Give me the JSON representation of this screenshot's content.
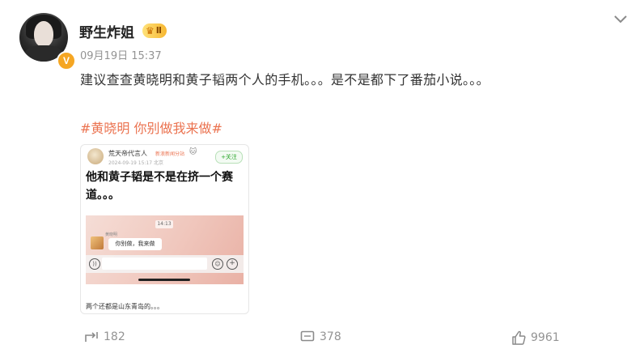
{
  "post": {
    "username": "野生炸姐",
    "level_badge": "Ⅱ",
    "verified_badge": "V",
    "time": "09月19日 15:37",
    "content": "建议查查黄晓明和黄子韬两个人的手机。。。是不是都下了番茄小说。。。",
    "topic": "#黄晓明 你别做我来做#"
  },
  "card": {
    "author": "荒天帝代言人",
    "tag": "新浪新闻分站",
    "small_icon": "🐱",
    "time": "2024-09-19 15:17 北京",
    "follow_label": "+关注",
    "title": "他和黄子韬是不是在挤一个赛道。。。",
    "screenshot": {
      "time": "14:13",
      "sender": "黄晓明",
      "bubble": "你别做，我来做"
    },
    "caption": "两个还都是山东青岛的。。。"
  },
  "actions": {
    "repost": "182",
    "comment": "378",
    "like": "9961"
  },
  "icons": {
    "verified": "verified-v-icon",
    "level": "crown-level-icon",
    "menu": "chevron-down-icon",
    "repost": "share-icon",
    "comment": "comment-icon",
    "like": "thumb-up-icon"
  },
  "colors": {
    "topic": "#eb7350",
    "meta": "#939393",
    "badge": "#f5a623"
  }
}
